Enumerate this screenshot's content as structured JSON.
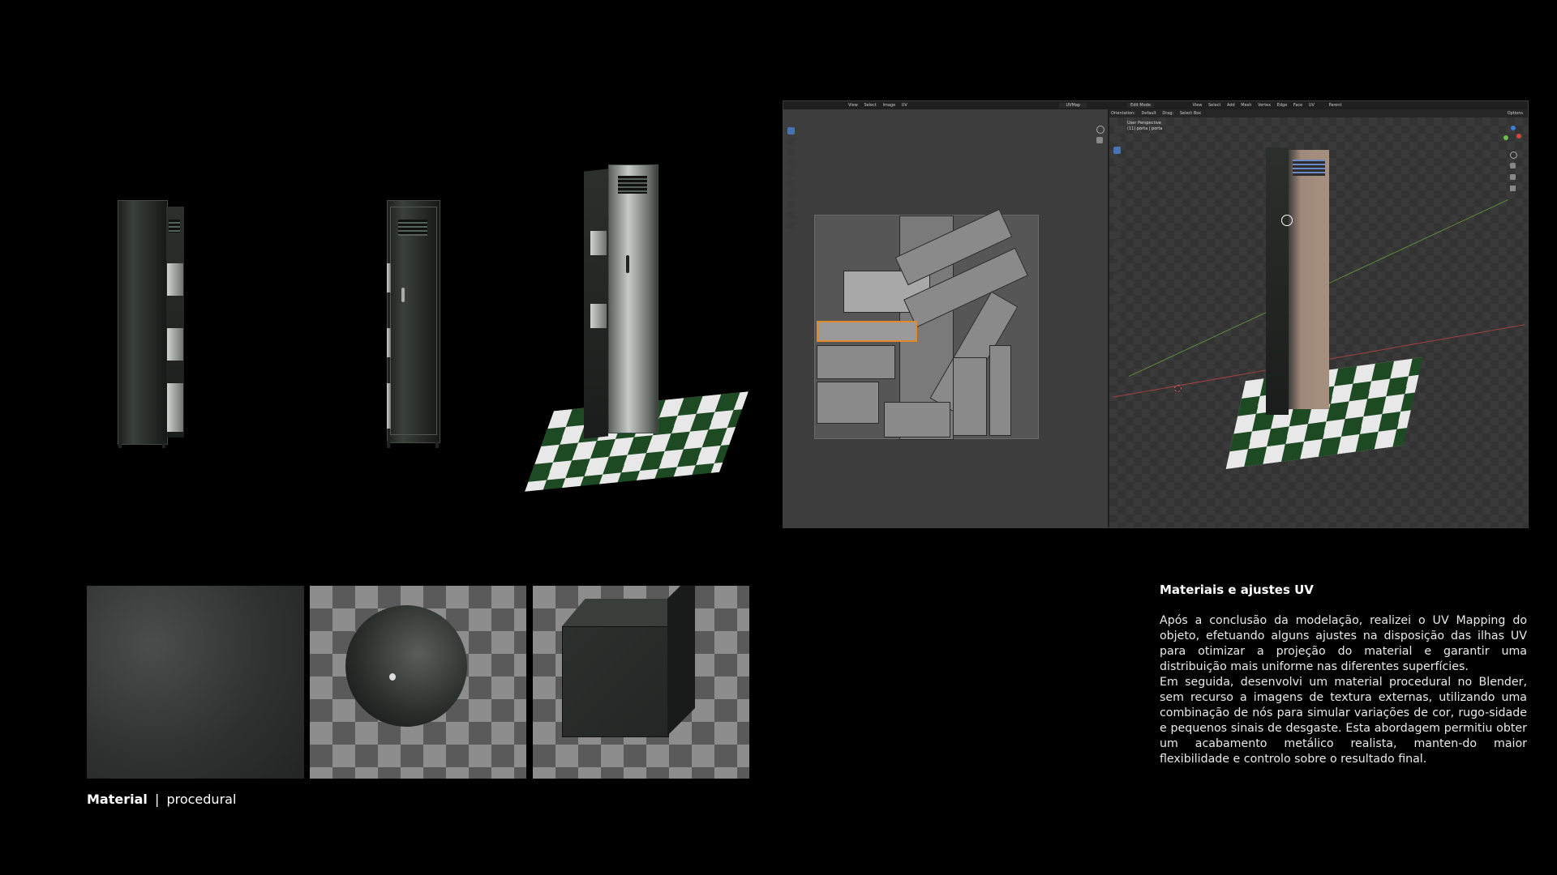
{
  "blender": {
    "uv_header_items": [
      "View",
      "Select",
      "Image",
      "UV"
    ],
    "uv_map_name": "UVMap",
    "viewport_header_items": [
      "Edit Mode",
      "View",
      "Select",
      "Add",
      "Mesh",
      "Vertex",
      "Edge",
      "Face",
      "UV"
    ],
    "viewport_subheader_items": [
      "Orientation:",
      "Default",
      "Drag:",
      "Select Box"
    ],
    "viewport_overlay_lines": [
      "User Perspective",
      "(11) porta | porta"
    ],
    "options_label": "Options",
    "transform_pivot": "Parent"
  },
  "section": {
    "title": "Materiais e ajustes UV",
    "body": [
      "Após a conclusão da modelação, realizei o UV Mapping do objeto, efetuando alguns ajustes na disposição das ilhas UV para otimizar a projeção do material e garantir uma distribuição mais uniforme nas diferentes superfícies.",
      "Em seguida, desenvolvi um material procedural no Blender, sem recurso a imagens de textura externas, utilizando uma combinação de nós para simular variações de cor, rugo-sidade e pequenos sinais de desgaste. Esta abordagem permitiu obter um acabamento metálico realista, manten-do maior flexibilidade e controlo sobre o resultado final."
    ]
  },
  "caption": {
    "bold": "Material",
    "separator": "|",
    "rest": "procedural"
  },
  "colors": {
    "background": "#000000",
    "checker_green": "#1d4a22",
    "blender_panel": "#2b2b2b",
    "active_tool": "#4772b3"
  }
}
